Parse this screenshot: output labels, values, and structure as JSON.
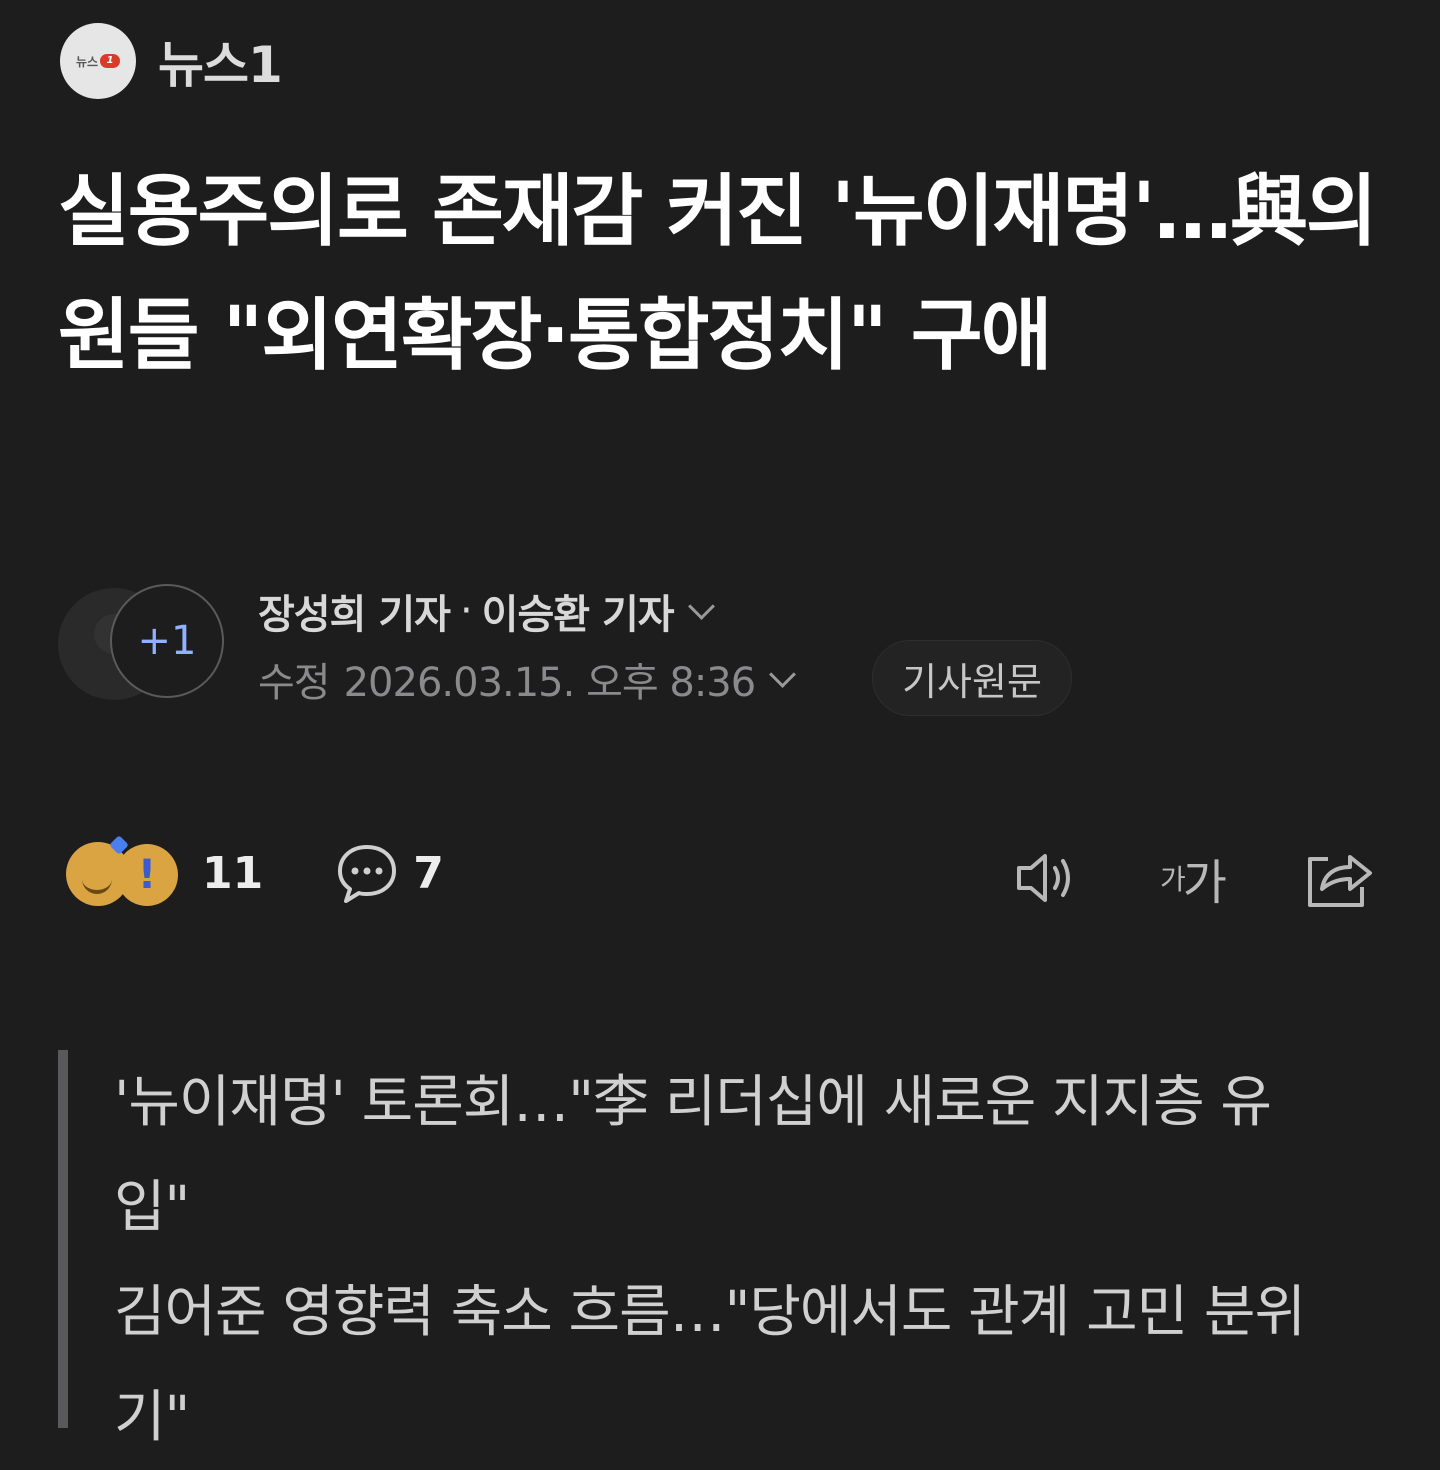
{
  "press": {
    "name": "뉴스1",
    "logo_text": "뉴스",
    "logo_mark": "1"
  },
  "headline": "실용주의로 존재감 커진 '뉴이재명'…與의원들 \"외연확장·통합정치\" 구애",
  "byline": {
    "reporters": [
      "장성희 기자",
      "이승환 기자"
    ],
    "separator": "·",
    "extra_count": "+1"
  },
  "dateline": {
    "label": "수정",
    "datetime": "2026.03.15. 오후 8:36"
  },
  "original_button": "기사원문",
  "reactions": {
    "count": "11",
    "emojis": [
      "smile-icon",
      "surprise-icon",
      "heart-icon"
    ]
  },
  "comments": {
    "count": "7",
    "icon": "comment-icon"
  },
  "toolbar": {
    "items": [
      "speaker-icon",
      "font-size-icon",
      "share-icon"
    ],
    "font_small": "가",
    "font_large": "가"
  },
  "summary": [
    "'뉴이재명' 토론회…\"李 리더십에 새로운 지지층 유입\"",
    "김어준 영향력 축소 흐름…\"당에서도 관계 고민 분위기\""
  ]
}
